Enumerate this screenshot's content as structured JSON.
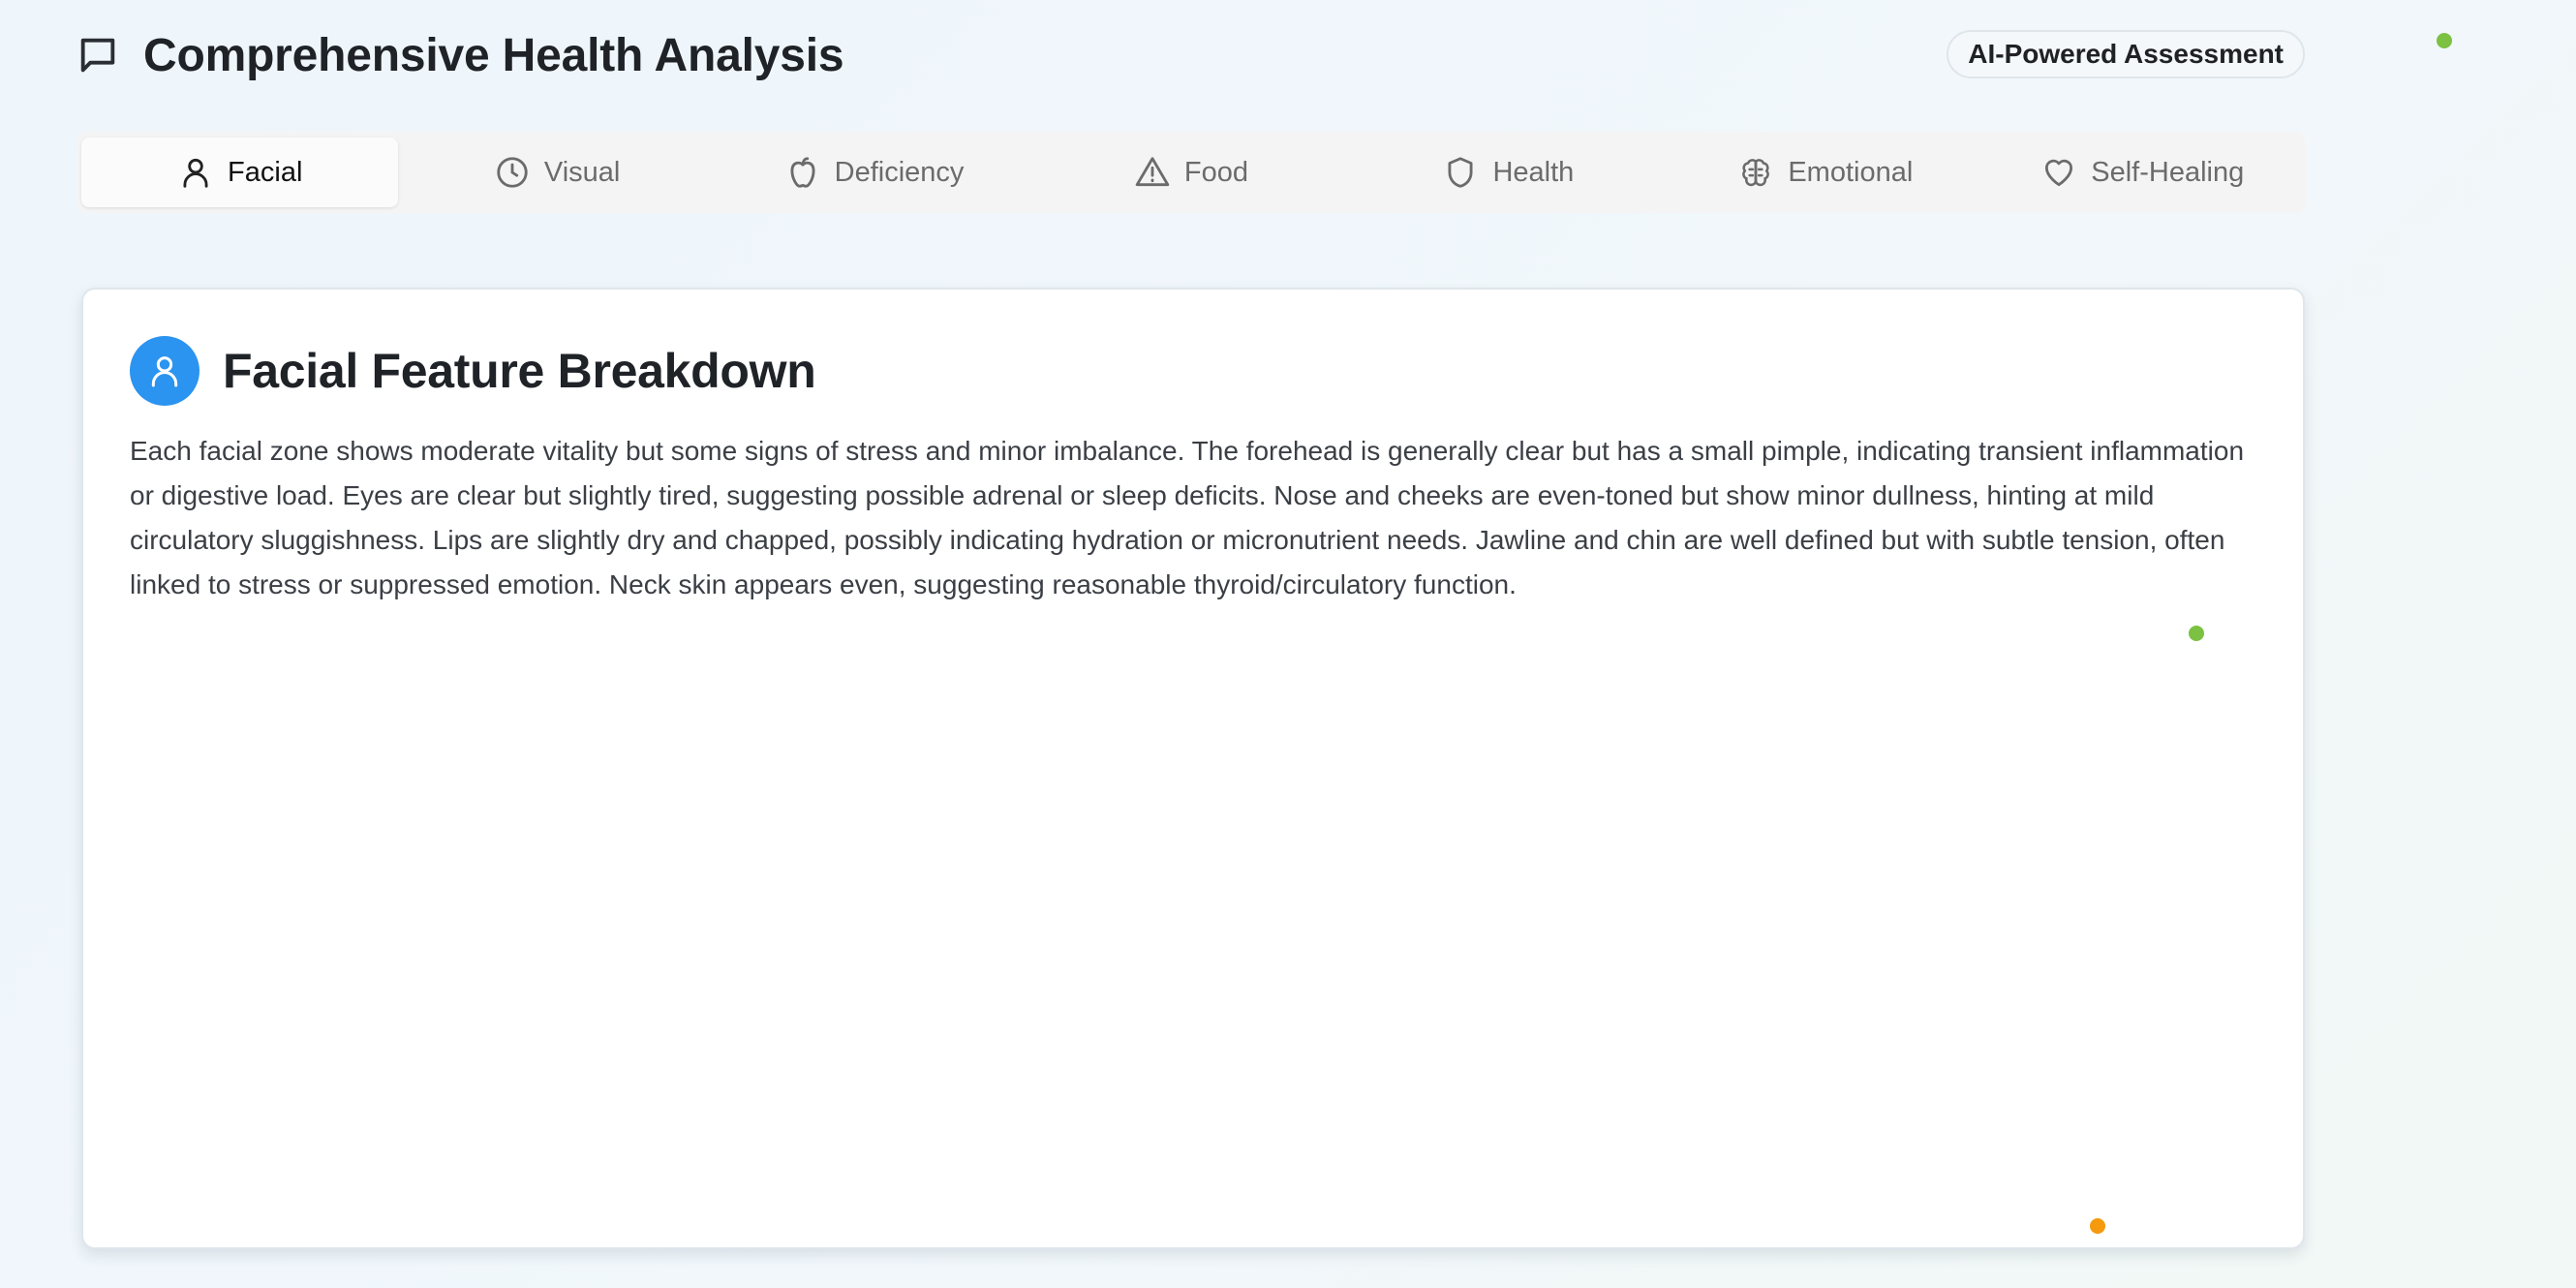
{
  "header": {
    "title": "Comprehensive Health Analysis",
    "badge": "AI-Powered Assessment"
  },
  "tabs": [
    {
      "label": "Facial",
      "icon": "user-icon",
      "active": true
    },
    {
      "label": "Visual",
      "icon": "clock-icon",
      "active": false
    },
    {
      "label": "Deficiency",
      "icon": "apple-icon",
      "active": false
    },
    {
      "label": "Food",
      "icon": "warning-icon",
      "active": false
    },
    {
      "label": "Health",
      "icon": "shield-icon",
      "active": false
    },
    {
      "label": "Emotional",
      "icon": "brain-icon",
      "active": false
    },
    {
      "label": "Self-Healing",
      "icon": "heart-icon",
      "active": false
    }
  ],
  "card": {
    "title": "Facial Feature Breakdown",
    "icon": "user-icon",
    "body": "Each facial zone shows moderate vitality but some signs of stress and minor imbalance. The forehead is generally clear but has a small pimple, indicating transient inflammation or digestive load. Eyes are clear but slightly tired, suggesting possible adrenal or sleep deficits. Nose and cheeks are even-toned but show minor dullness, hinting at mild circulatory sluggishness. Lips are slightly dry and chapped, possibly indicating hydration or micronutrient needs. Jawline and chin are well defined but with subtle tension, often linked to stress or suppressed emotion. Neck skin appears even, suggesting reasonable thyroid/circulatory function."
  },
  "colors": {
    "accent": "#2b93f0",
    "dot_green": "#7cc142",
    "dot_orange": "#f59a0c"
  }
}
